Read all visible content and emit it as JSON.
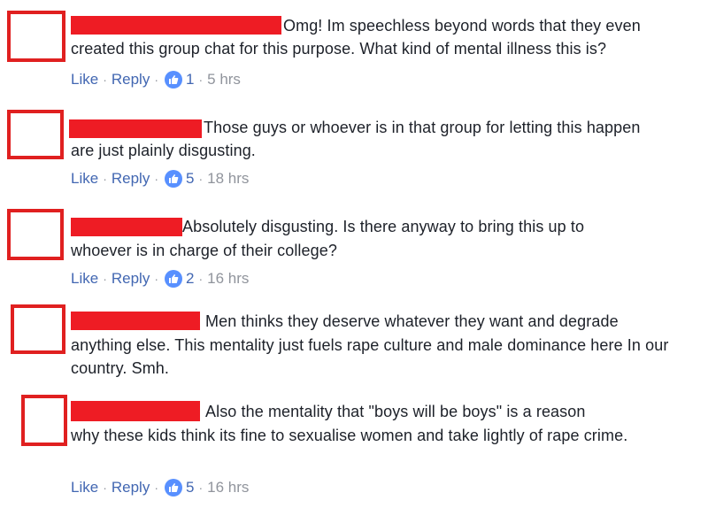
{
  "colors": {
    "accent": "#4267b2",
    "redaction": "#ee1c24",
    "muted": "#90949c"
  },
  "comments": [
    {
      "text_line1": "Omg! Im speechless beyond words that they even",
      "text_rest": "created this group chat for this purpose. What kind of mental illness this is?",
      "like": "Like",
      "reply": "Reply",
      "reactions": "1",
      "time": "5 hrs"
    },
    {
      "text_line1": "Those guys or whoever is in that group for letting this happen",
      "text_rest": "are just plainly disgusting.",
      "like": "Like",
      "reply": "Reply",
      "reactions": "5",
      "time": "18 hrs"
    },
    {
      "text_line1": "Absolutely disgusting. Is there anyway to bring this up to",
      "text_rest": "whoever is in charge of their college?",
      "like": "Like",
      "reply": "Reply",
      "reactions": "2",
      "time": "16 hrs"
    },
    {
      "text_line1": "Men thinks they deserve whatever they want and degrade",
      "text_rest": "anything else. This mentality just fuels rape culture and male dominance here In our country. Smh."
    },
    {
      "text_line1": "Also the mentality that \"boys will be boys\" is a reason",
      "text_rest": "why these kids think its fine to sexualise women and take lightly of rape crime.",
      "like": "Like",
      "reply": "Reply",
      "reactions": "5",
      "time": "16 hrs"
    }
  ]
}
